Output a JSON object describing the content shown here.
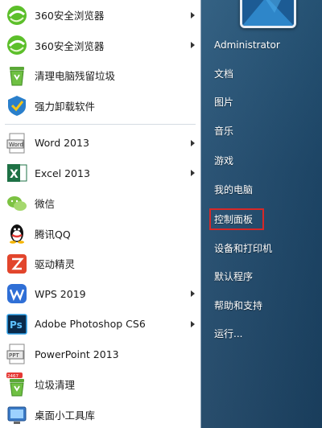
{
  "left_pane": {
    "items": [
      {
        "label": "360安全浏览器",
        "icon": "360-browser-icon",
        "has_arrow": true
      },
      {
        "label": "360安全浏览器",
        "icon": "360-browser-icon",
        "has_arrow": true
      },
      {
        "label": "清理电脑残留垃圾",
        "icon": "recycle-bin-icon",
        "has_arrow": false
      },
      {
        "label": "强力卸载软件",
        "icon": "uninstaller-icon",
        "has_arrow": false
      },
      {
        "label": "Word 2013",
        "icon": "word-icon",
        "has_arrow": true
      },
      {
        "label": "Excel 2013",
        "icon": "excel-icon",
        "has_arrow": true
      },
      {
        "label": "微信",
        "icon": "wechat-icon",
        "has_arrow": false
      },
      {
        "label": "腾讯QQ",
        "icon": "qq-icon",
        "has_arrow": false
      },
      {
        "label": "驱动精灵",
        "icon": "driver-genius-icon",
        "has_arrow": false
      },
      {
        "label": "WPS 2019",
        "icon": "wps-icon",
        "has_arrow": true
      },
      {
        "label": "Adobe Photoshop CS6",
        "icon": "photoshop-icon",
        "has_arrow": true
      },
      {
        "label": "PowerPoint 2013",
        "icon": "powerpoint-icon",
        "has_arrow": false
      },
      {
        "label": "垃圾清理",
        "icon": "trash-cleaner-icon",
        "has_arrow": false
      },
      {
        "label": "桌面小工具库",
        "icon": "gadgets-icon",
        "has_arrow": false
      }
    ],
    "badge": "2467"
  },
  "right_pane": {
    "user_name": "Administrator",
    "items": [
      "文档",
      "图片",
      "音乐",
      "游戏",
      "我的电脑",
      "控制面板",
      "设备和打印机",
      "默认程序",
      "帮助和支持",
      "运行..."
    ],
    "highlighted": "控制面板"
  },
  "colors": {
    "highlight_border": "#d62828",
    "right_pane_bg": "#1f4a6d"
  }
}
